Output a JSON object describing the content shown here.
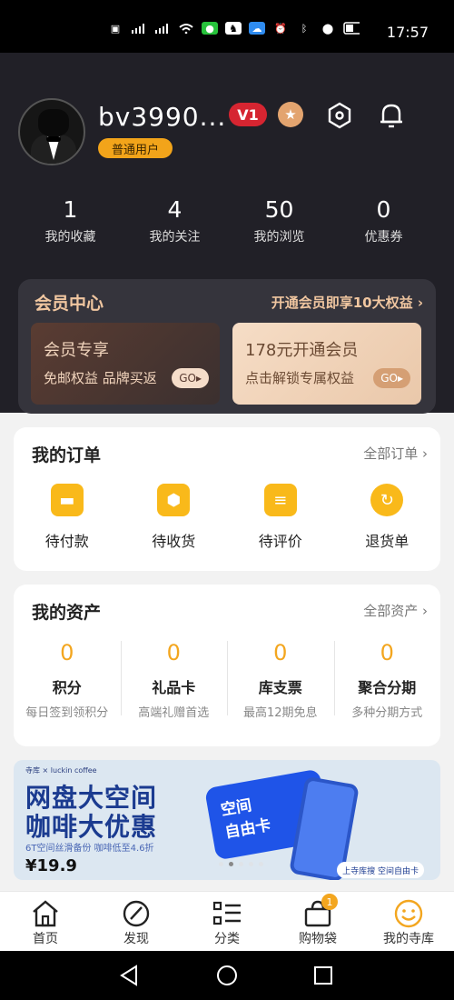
{
  "status_bar": {
    "time": "17:57",
    "icons": [
      "hd1-icon",
      "hd2-icon",
      "signal-5g-icon",
      "signal-4g-icon",
      "wifi-icon",
      "wechat-icon",
      "qq-icon",
      "cloud-icon",
      "alarm-icon",
      "bluetooth-icon",
      "location-icon",
      "battery-icon"
    ]
  },
  "profile": {
    "username": "bv3990...",
    "badge": "普通用户"
  },
  "stats": [
    {
      "value": "1",
      "label": "我的收藏"
    },
    {
      "value": "4",
      "label": "我的关注"
    },
    {
      "value": "50",
      "label": "我的浏览"
    },
    {
      "value": "0",
      "label": "优惠券"
    }
  ],
  "member_center": {
    "title": "会员中心",
    "link": "开通会员即享10大权益",
    "cards": [
      {
        "title": "会员专享",
        "subtitle": "免邮权益 品牌买返",
        "button": "GO"
      },
      {
        "title": "178元开通会员",
        "subtitle": "点击解锁专属权益",
        "button": "GO"
      }
    ]
  },
  "orders": {
    "title": "我的订单",
    "link": "全部订单",
    "items": [
      {
        "label": "待付款",
        "icon": "wallet-icon"
      },
      {
        "label": "待收货",
        "icon": "package-icon"
      },
      {
        "label": "待评价",
        "icon": "comment-icon"
      },
      {
        "label": "退货单",
        "icon": "refresh-icon"
      }
    ]
  },
  "assets": {
    "title": "我的资产",
    "link": "全部资产",
    "items": [
      {
        "value": "0",
        "label": "积分",
        "sub": "每日签到领积分"
      },
      {
        "value": "0",
        "label": "礼品卡",
        "sub": "高端礼赠首选"
      },
      {
        "value": "0",
        "label": "库支票",
        "sub": "最高12期免息"
      },
      {
        "value": "0",
        "label": "聚合分期",
        "sub": "多种分期方式"
      }
    ]
  },
  "banner": {
    "brand": "寺库 × luckin coffee",
    "title1": "网盘大空间",
    "title2": "咖啡大优惠",
    "subtitle": "6T空间丝滑备份 咖啡低至4.6折",
    "price": "¥19.9",
    "card_text": "空间\n自由卡",
    "tag": "上寺库搜 空间自由卡"
  },
  "tabbar": [
    {
      "label": "首页",
      "icon": "home-icon"
    },
    {
      "label": "发现",
      "icon": "compass-icon"
    },
    {
      "label": "分类",
      "icon": "category-icon"
    },
    {
      "label": "购物袋",
      "icon": "bag-icon",
      "badge": "1"
    },
    {
      "label": "我的寺库",
      "icon": "smile-icon"
    }
  ],
  "colors": {
    "accent": "#f3a61f",
    "header_bg": "#212027",
    "member_gold": "#f0c6a0"
  }
}
